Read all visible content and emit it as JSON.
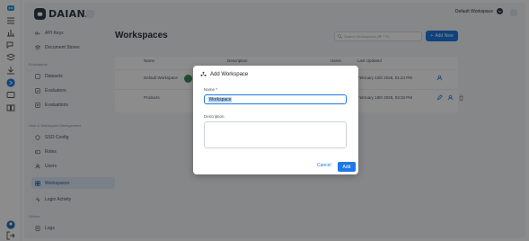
{
  "app": {
    "brand": "DAIANA"
  },
  "header": {
    "workspace_selector": "Default Workspace"
  },
  "sidebar": {
    "items_top": [
      {
        "label": "API Keys",
        "icon": "key-icon"
      },
      {
        "label": "Document Stores",
        "icon": "stack-icon"
      }
    ],
    "section_evaluations": "Evaluations",
    "items_eval": [
      {
        "label": "Datasets",
        "icon": "dataset-icon"
      },
      {
        "label": "Evaluators",
        "icon": "evaluator-icon"
      },
      {
        "label": "Evaluations",
        "icon": "evaluation-icon"
      }
    ],
    "section_management": "User & Workspace Management",
    "items_mgmt": [
      {
        "label": "SSO Config",
        "icon": "shield-icon"
      },
      {
        "label": "Roles",
        "icon": "roles-icon"
      },
      {
        "label": "Users",
        "icon": "users-icon"
      },
      {
        "label": "Workspaces",
        "icon": "workspaces-icon",
        "active": true
      },
      {
        "label": "Login Activity",
        "icon": "activity-icon"
      }
    ],
    "section_others": "Others",
    "items_others": [
      {
        "label": "Logs",
        "icon": "logs-icon"
      }
    ]
  },
  "main": {
    "title": "Workspaces",
    "search_placeholder": "Search Workspaces (⌘ + F)",
    "add_new_label": "Add New",
    "columns": [
      "Name",
      "Description",
      "Users",
      "Last Updated"
    ],
    "rows": [
      {
        "name": "Default Workspace",
        "description": "",
        "users": "",
        "last_updated": "February 12th 2026, 01:24 PM"
      },
      {
        "name": "Products",
        "description": "",
        "users": "",
        "last_updated": "February 18th 2026, 03:33 PM"
      }
    ]
  },
  "modal": {
    "title": "Add Workspace",
    "name_label": "Name *",
    "name_value": "Workspace",
    "description_label": "Description",
    "description_value": "",
    "cancel_label": "Cancel",
    "add_label": "Add"
  },
  "colors": {
    "primary": "#1e78e6",
    "brand_dark": "#2f3b4d",
    "active_bg": "#dfe9f6"
  }
}
